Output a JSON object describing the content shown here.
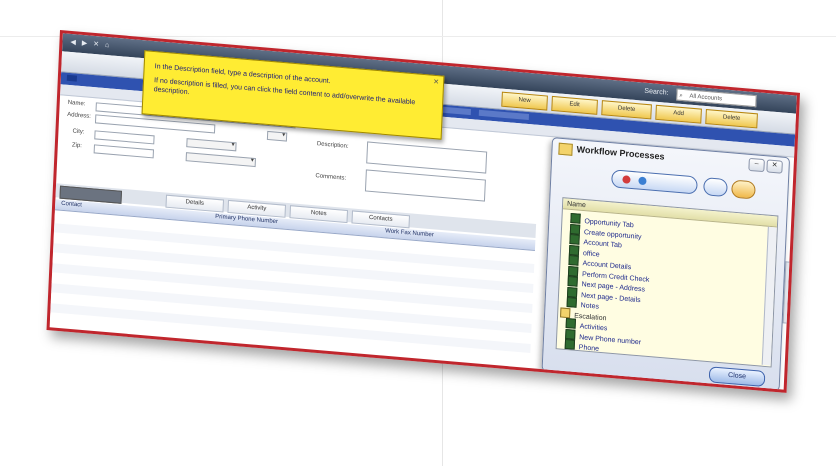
{
  "window": {
    "title_dots": "◀ ▶ ✕ ⌂",
    "search_label": "Search:",
    "search_placeholder": "All Accounts"
  },
  "toolbar": {
    "buttons": [
      "New",
      "Edit",
      "Delete",
      "Add",
      "Delete"
    ]
  },
  "tooltip": {
    "line1": "In the Description field, type a description of the account.",
    "line2": "If no description is filled, you can click the field content to add/overwrite the available description."
  },
  "dialog": {
    "title": "Workflow Processes",
    "list_header": "Name",
    "items": [
      {
        "label": "Opportunity Tab",
        "folder": false
      },
      {
        "label": "Create opportunity",
        "folder": false
      },
      {
        "label": "Account Tab",
        "folder": false
      },
      {
        "label": "office",
        "folder": false
      },
      {
        "label": "Account Details",
        "folder": false
      },
      {
        "label": "Perform Credit Check",
        "folder": false
      },
      {
        "label": "Next page - Address",
        "folder": false
      },
      {
        "label": "Next page - Details",
        "folder": false
      },
      {
        "label": "Notes",
        "folder": false
      },
      {
        "label": "Escalation",
        "folder": true
      },
      {
        "label": "Activities",
        "folder": false
      },
      {
        "label": "New Phone number",
        "folder": false
      },
      {
        "label": "Phone",
        "folder": false
      }
    ],
    "close_label": "Close"
  },
  "form": {
    "labels": [
      "Name:",
      "Address:",
      "City:",
      "Zip:",
      "Description:",
      "Comments:"
    ],
    "values": [
      "",
      "",
      "",
      "",
      ""
    ]
  },
  "grid": {
    "tabs": [
      "",
      "Details",
      "Activity",
      "Notes",
      "Contacts"
    ],
    "headers": [
      "Contact",
      "Primary Phone Number",
      "Work Fax Number"
    ],
    "rows": [
      [
        "",
        "",
        ""
      ],
      [
        "",
        "",
        ""
      ],
      [
        "",
        "",
        ""
      ],
      [
        "",
        "",
        ""
      ],
      [
        "",
        "",
        ""
      ],
      [
        "",
        "",
        ""
      ],
      [
        "",
        "",
        ""
      ],
      [
        "",
        "",
        ""
      ],
      [
        "",
        "",
        ""
      ],
      [
        "",
        "",
        ""
      ],
      [
        "",
        "",
        ""
      ]
    ]
  },
  "colors": {
    "frame_border": "#c0262d",
    "tooltip_bg": "#ffec33",
    "nav_bg": "#2f52b0",
    "list_bg": "#fffde2"
  }
}
